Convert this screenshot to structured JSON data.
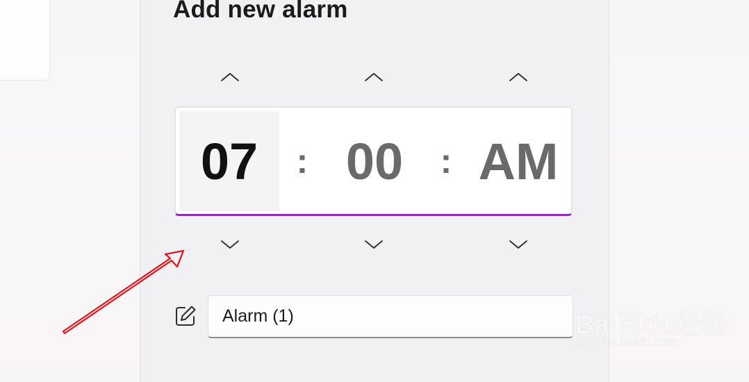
{
  "dialog": {
    "title": "Add new alarm"
  },
  "time_picker": {
    "hour": "07",
    "minute": "00",
    "period": "AM",
    "separator": ":",
    "selected_segment": "hour"
  },
  "name_field": {
    "value": "Alarm (1)"
  },
  "icons": {
    "increment": "chevron-up-icon",
    "decrement": "chevron-down-icon",
    "edit": "edit-icon"
  },
  "colors": {
    "accent": "#8e2fb3",
    "annotation": "#e0141e"
  },
  "watermark": {
    "brand": "Bai百du经验",
    "url": "jingyan.baidu.com"
  }
}
